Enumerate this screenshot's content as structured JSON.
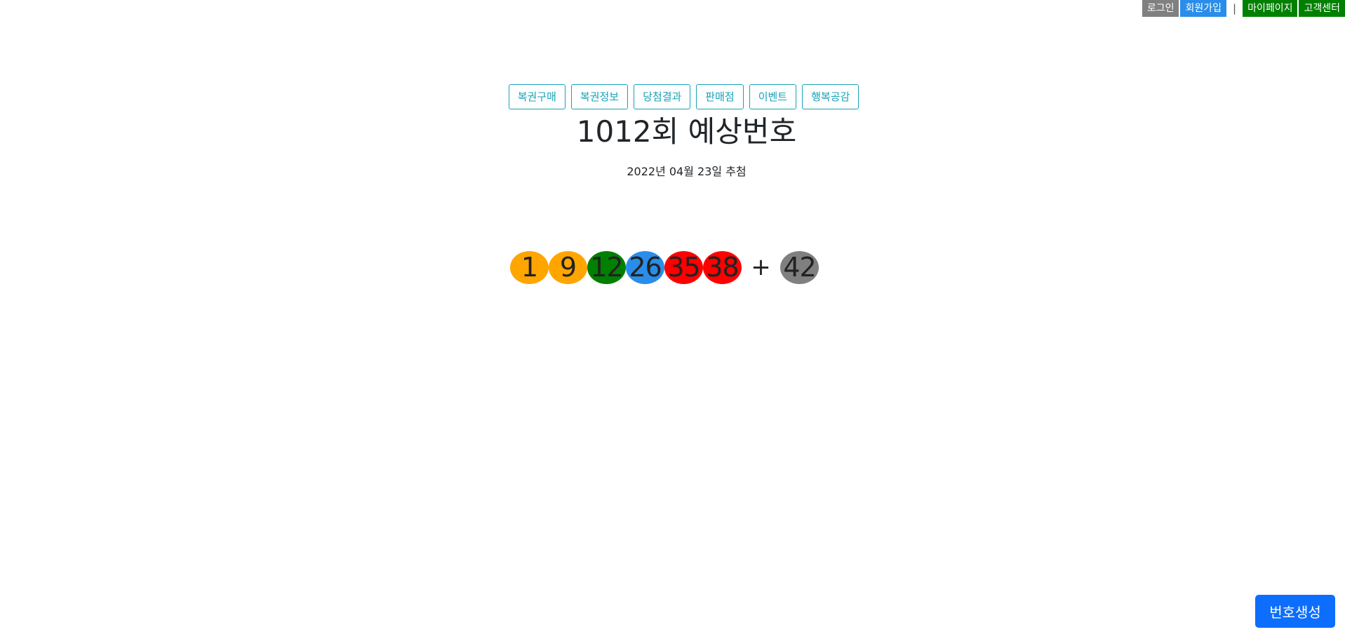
{
  "account_bar": {
    "login": "로그인",
    "signup": "회원가입",
    "separator": "|",
    "mypage": "마이페이지",
    "support": "고객센터",
    "colors": {
      "login": "#808080",
      "signup": "#2a8de9",
      "mypage": "#008000",
      "support": "#008000"
    }
  },
  "nav": {
    "items": [
      {
        "label": "복권구매"
      },
      {
        "label": "복권정보"
      },
      {
        "label": "당첨결과"
      },
      {
        "label": "판매점"
      },
      {
        "label": "이벤트"
      },
      {
        "label": "행복공감"
      }
    ]
  },
  "draw": {
    "title": "1012회 예상번호",
    "date": "2022년 04월 23일 추첨"
  },
  "numbers": {
    "main": [
      {
        "value": "1",
        "color": "#ffa500"
      },
      {
        "value": "9",
        "color": "#ffa500"
      },
      {
        "value": "12",
        "color": "#008000"
      },
      {
        "value": "26",
        "color": "#2a8de9"
      },
      {
        "value": "35",
        "color": "#ff0000"
      },
      {
        "value": "38",
        "color": "#ff0000"
      }
    ],
    "plus": "+",
    "bonus": {
      "value": "42",
      "color": "#808080"
    }
  },
  "generate_button": {
    "label": "번호생성",
    "color": "#0d6efd"
  }
}
